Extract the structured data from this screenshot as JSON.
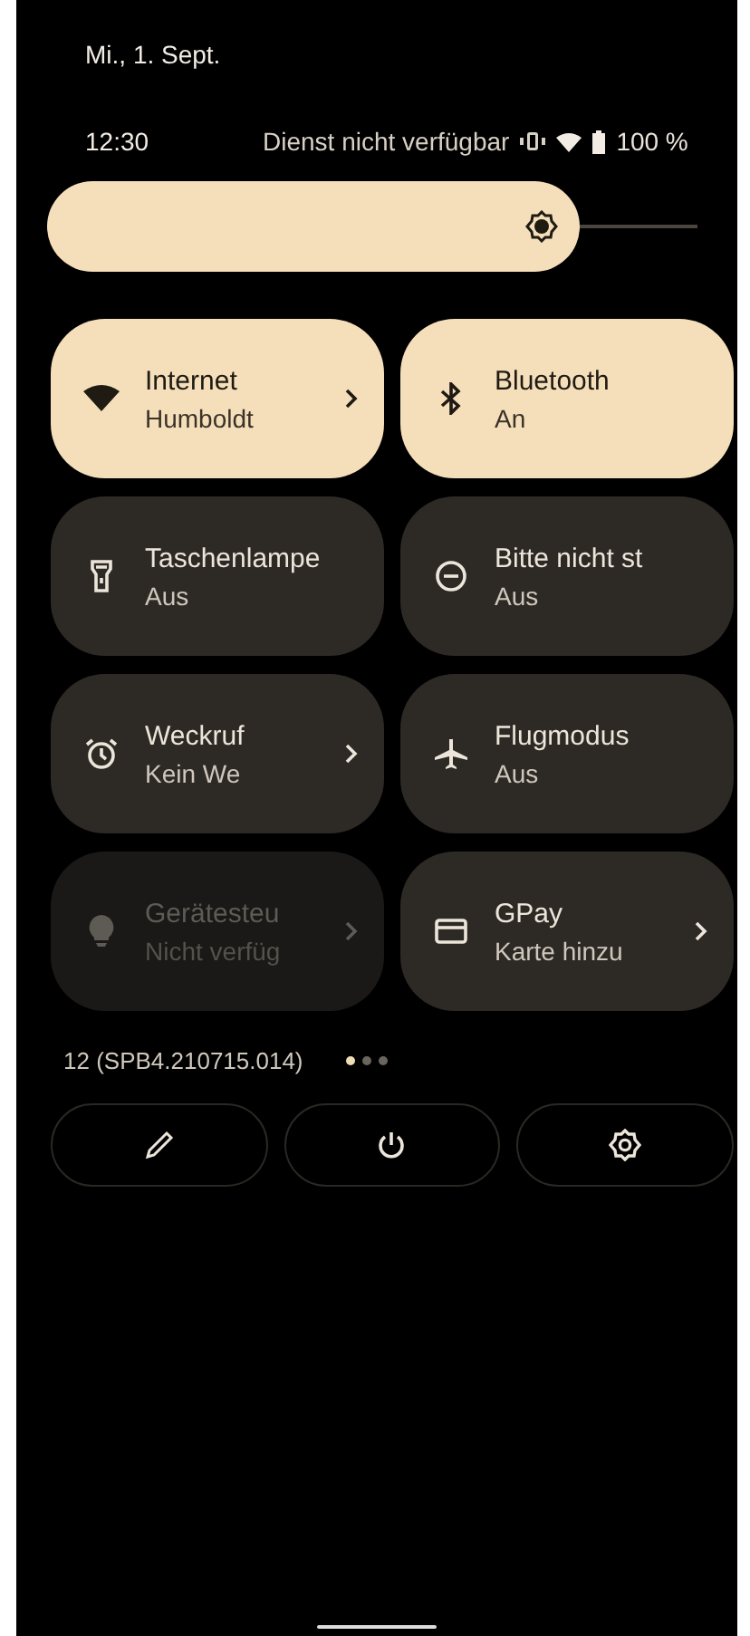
{
  "header": {
    "date": "Mi., 1. Sept.",
    "time": "12:30",
    "carrier": "Dienst nicht verfügbar",
    "battery": "100 %"
  },
  "brightness": {
    "level": 0.82
  },
  "tiles": [
    {
      "kind": "internet",
      "label": "Internet",
      "status": "Humboldt",
      "on": true,
      "disabled": false,
      "chevron": true
    },
    {
      "kind": "bluetooth",
      "label": "Bluetooth",
      "status": "An",
      "on": true,
      "disabled": false,
      "chevron": false
    },
    {
      "kind": "flashlight",
      "label": "Taschenlampe",
      "status": "Aus",
      "on": false,
      "disabled": false,
      "chevron": false
    },
    {
      "kind": "dnd",
      "label": "Bitte nicht st",
      "status": "Aus",
      "on": false,
      "disabled": false,
      "chevron": false
    },
    {
      "kind": "alarm",
      "label": "Weckruf",
      "status": "Kein We",
      "on": false,
      "disabled": false,
      "chevron": true
    },
    {
      "kind": "airplane",
      "label": "Flugmodus",
      "status": "Aus",
      "on": false,
      "disabled": false,
      "chevron": false
    },
    {
      "kind": "devices",
      "label": "Gerätesteu",
      "status": "Nicht verfüg",
      "on": false,
      "disabled": true,
      "chevron": true
    },
    {
      "kind": "wallet",
      "label": "GPay",
      "status": "Karte hinzu",
      "on": false,
      "disabled": false,
      "chevron": true
    }
  ],
  "build": "12 (SPB4.210715.014)",
  "pages": [
    {
      "selected": true
    },
    {
      "selected": false
    },
    {
      "selected": false
    }
  ],
  "footer_buttons": [
    {
      "kind": "edit"
    },
    {
      "kind": "power"
    },
    {
      "kind": "settings"
    }
  ]
}
